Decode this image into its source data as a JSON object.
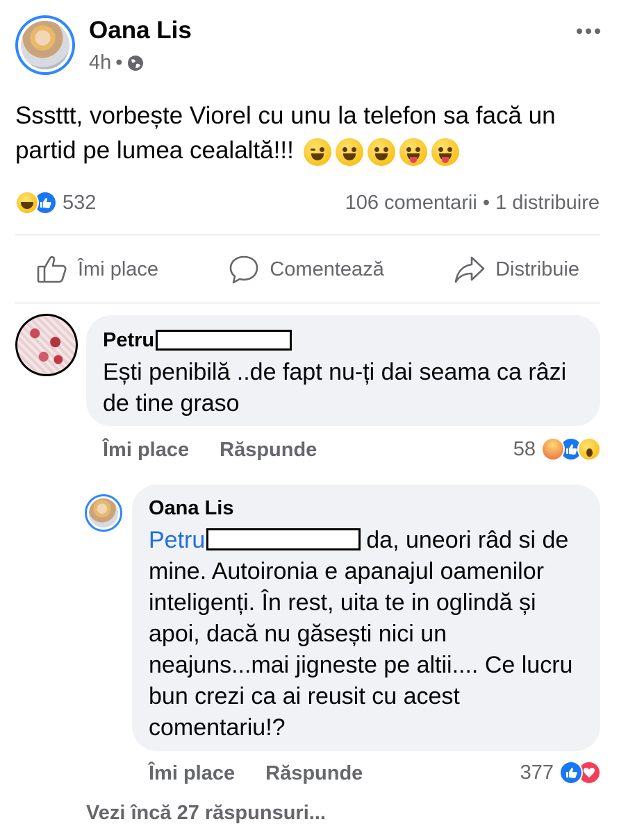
{
  "post": {
    "author": "Oana Lis",
    "time": "4h",
    "audience_icon": "globe-icon",
    "text": "Sssttt, vorbește Viorel cu unu la telefon sa facă un partid pe lumea cealaltă!!!",
    "emojis": [
      "wink",
      "smile",
      "grin",
      "tongue",
      "tongue"
    ],
    "reaction_count": "532",
    "comments_count": "106 comentarii",
    "shares_count": "1 distribuire"
  },
  "actions": {
    "like": "Îmi place",
    "comment": "Comentează",
    "share": "Distribuie"
  },
  "comments": [
    {
      "author": "Petru",
      "text": "Ești penibilă ..de fapt nu-ți dai seama ca râzi de tine graso",
      "like_label": "Îmi place",
      "reply_label": "Răspunde",
      "reaction_count": "58"
    },
    {
      "author": "Oana Lis",
      "mention": "Petru",
      "text": "da, uneori râd si de mine. Autoironia e apanajul oamenilor inteligenți.  În rest, uita te in oglindă și apoi, dacă nu găsești nici un neajuns...mai jigneste pe altii.... Ce lucru bun crezi ca ai reusit cu acest comentariu!?",
      "like_label": "Îmi place",
      "reply_label": "Răspunde",
      "reaction_count": "377"
    }
  ],
  "more_replies": "Vezi încă 27 răspunsuri...",
  "colors": {
    "brand_blue": "#1877f2",
    "mention_blue": "#216fdb",
    "muted_text": "#65676b",
    "bubble_bg": "#f0f2f5"
  }
}
